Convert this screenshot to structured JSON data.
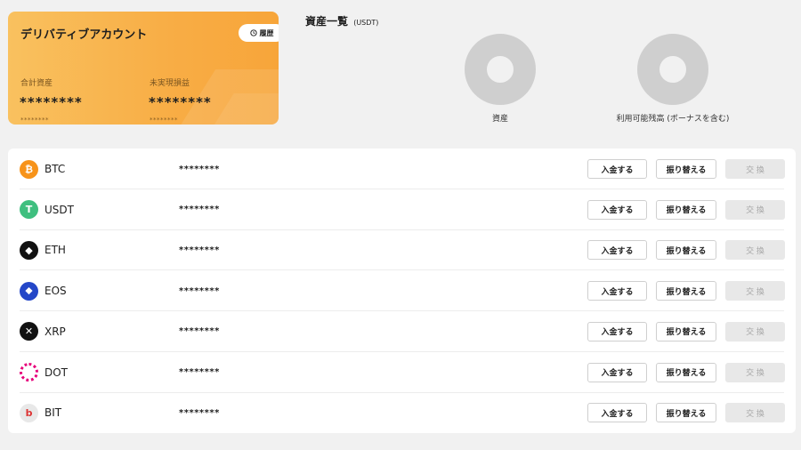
{
  "account": {
    "title": "デリバティブアカウント",
    "history_label": "履歴",
    "total_label": "合計資産",
    "total_value": "********",
    "total_sub": "********",
    "unrealized_label": "未実現損益",
    "unrealized_value": "********",
    "unrealized_sub": "********"
  },
  "overview": {
    "title": "資産一覧",
    "unit": "(USDT)",
    "donuts": [
      {
        "label": "資産"
      },
      {
        "label": "利用可能残高 (ボーナスを含む)"
      }
    ]
  },
  "actions": {
    "deposit": "入金する",
    "transfer": "振り替える",
    "exchange": "交 換"
  },
  "coins": [
    {
      "name": "BTC",
      "balance": "********",
      "icon": "bitcoin-icon",
      "color": "#f7931a",
      "glyph": "₿"
    },
    {
      "name": "USDT",
      "balance": "********",
      "icon": "tether-icon",
      "color": "#3fbf7f",
      "glyph": "T"
    },
    {
      "name": "ETH",
      "balance": "********",
      "icon": "ethereum-icon",
      "color": "#111111",
      "glyph": "◆"
    },
    {
      "name": "EOS",
      "balance": "********",
      "icon": "eos-icon",
      "color": "#2447c8",
      "glyph": "⬥"
    },
    {
      "name": "XRP",
      "balance": "********",
      "icon": "xrp-icon",
      "color": "#111111",
      "glyph": "✕"
    },
    {
      "name": "DOT",
      "balance": "********",
      "icon": "polkadot-icon",
      "color": "#e6007a",
      "glyph": "●"
    },
    {
      "name": "BIT",
      "balance": "********",
      "icon": "bit-icon",
      "color": "#e8e8e8",
      "glyph": "b"
    }
  ]
}
